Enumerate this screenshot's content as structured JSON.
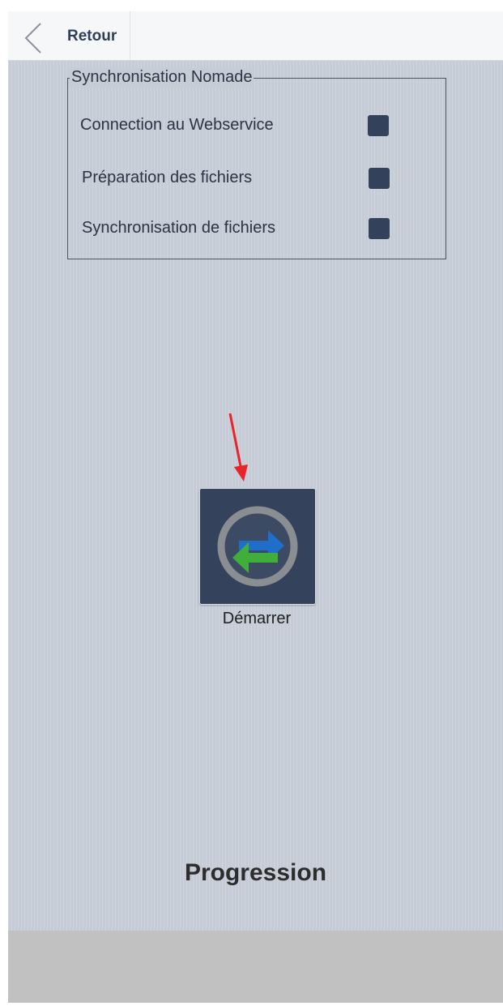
{
  "header": {
    "back_label": "Retour",
    "back_icon": "chevron-left-icon"
  },
  "sync_group": {
    "title": "Synchronisation Nomade",
    "items": [
      {
        "label": "Connection au Webservice",
        "checked": false
      },
      {
        "label": "Préparation des fichiers",
        "checked": false
      },
      {
        "label": "Synchronisation de fichiers",
        "checked": false
      }
    ]
  },
  "start": {
    "label": "Démarrer",
    "icon": "sync-arrows-icon"
  },
  "annotation": {
    "icon": "red-arrow-annotation"
  },
  "progress": {
    "title": "Progression"
  },
  "colors": {
    "background": "#c6ccd6",
    "checkbox": "#33415a",
    "tile": "#34425c",
    "footer": "#c1c1c1",
    "arrow_blue": "#1f6ec9",
    "arrow_green": "#3fae3a",
    "annotation_red": "#e8232a"
  }
}
